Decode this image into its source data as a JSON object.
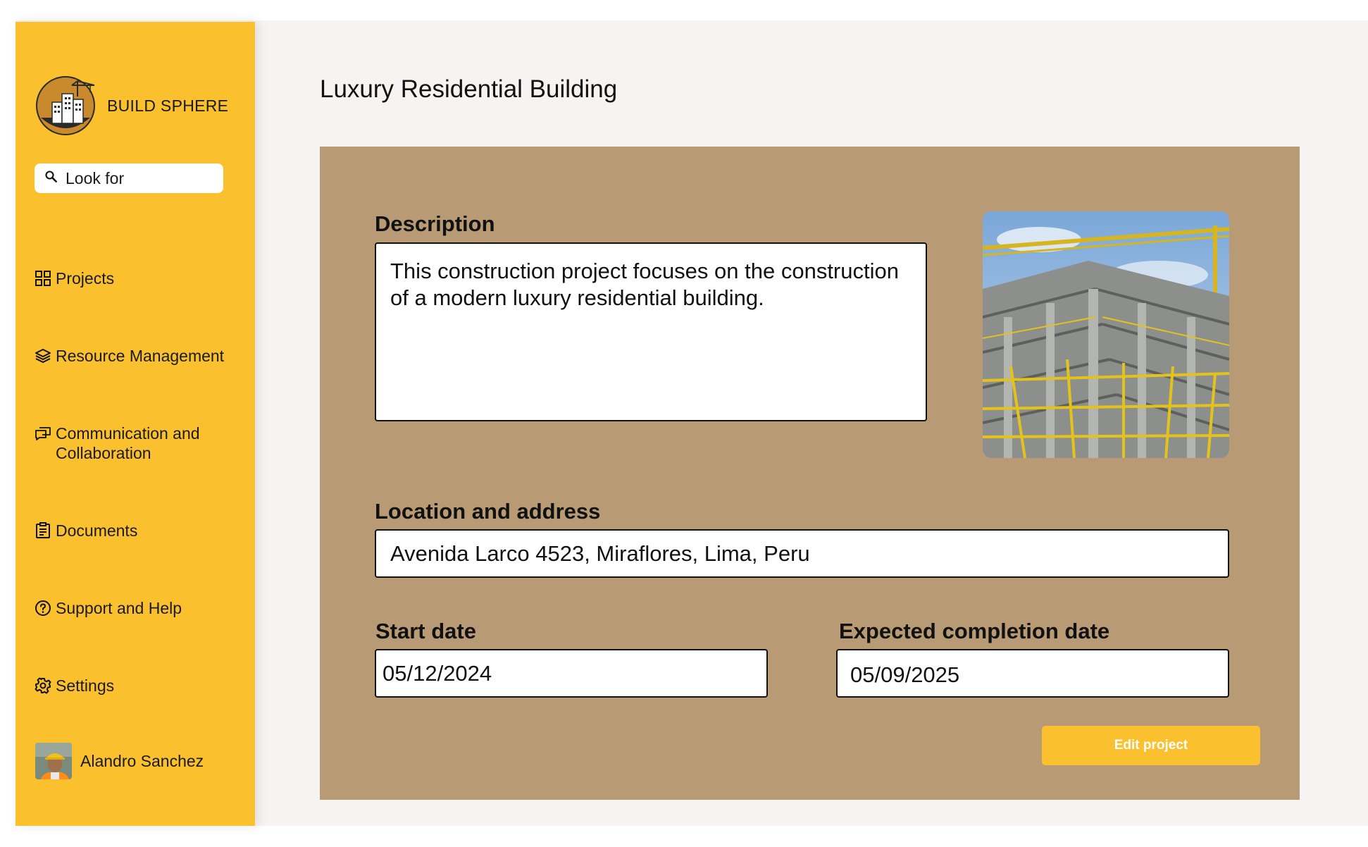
{
  "brand": {
    "name": "BUILD SPHERE"
  },
  "search": {
    "label": "Look for"
  },
  "nav": {
    "projects": "Projects",
    "resources": "Resource Management",
    "communication": "Communication and Collaboration",
    "documents": "Documents",
    "support": "Support and Help",
    "settings": "Settings"
  },
  "user": {
    "name": "Alandro Sanchez"
  },
  "project": {
    "title": "Luxury Residential Building",
    "description_label": "Description",
    "description": "This construction project focuses on the construction of a modern luxury residential building.",
    "location_label": "Location and address",
    "location": "Avenida Larco 4523, Miraflores, Lima, Peru",
    "start_label": "Start date",
    "start_date": "05/12/2024",
    "end_label": "Expected completion date",
    "end_date": "05/09/2025",
    "edit_label": "Edit project"
  },
  "icons": {
    "logo": "construction-logo-icon",
    "search": "search-icon",
    "projects": "grid-icon",
    "resources": "layers-icon",
    "communication": "chat-icon",
    "documents": "clipboard-icon",
    "support": "help-circle-icon",
    "settings": "gear-icon"
  },
  "colors": {
    "sidebar": "#fbc02d",
    "card": "#b89b74",
    "background": "#f6f3f2",
    "button": "#fbc02d"
  }
}
